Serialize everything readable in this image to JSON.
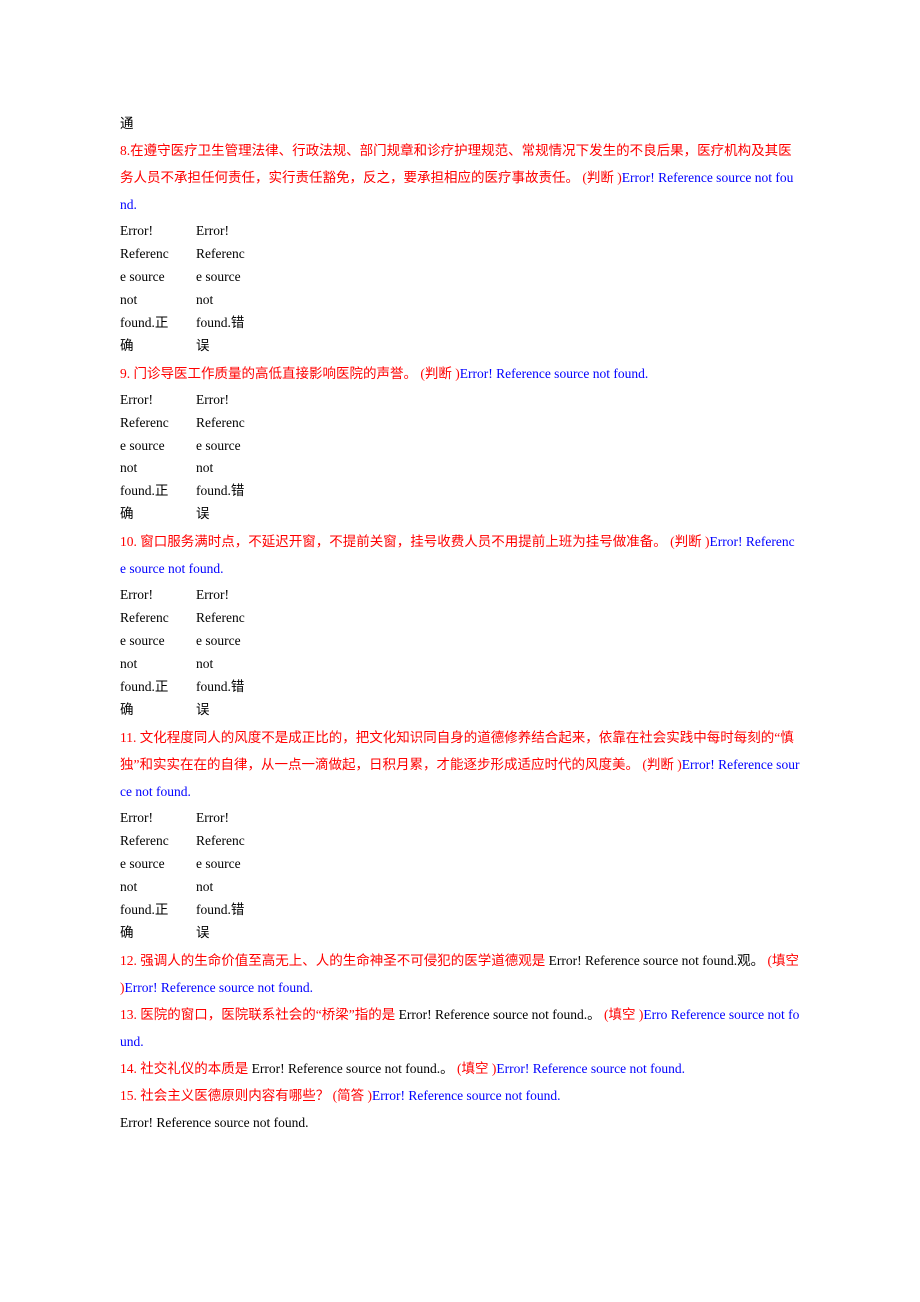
{
  "top_fragment": "通",
  "error_ref": "Error! Reference source not found.",
  "tf_correct_lines": [
    "Error!",
    "Referenc",
    "e source",
    "not",
    "found.正",
    "确"
  ],
  "tf_wrong_lines": [
    "Error!",
    "Referenc",
    "e source",
    "not",
    "found.错",
    "误"
  ],
  "q8": {
    "num": "8.",
    "text": "在遵守医疗卫生管理法律、行政法规、部门规章和诊疗护理规范、常规情况下发生的不良后果，医疗机构及其医务人员不承担任何责任，实行责任豁免，反之，要承担相应的医疗事故责任。",
    "type": " (判断 )"
  },
  "q9": {
    "num": "9. ",
    "text": "门诊导医工作质量的高低直接影响医院的声誉。",
    "type": " (判断 )"
  },
  "q10": {
    "num": "10. ",
    "text": "窗口服务满时点，不延迟开窗，不提前关窗，挂号收费人员不用提前上班为挂号做准备。",
    "type": " (判断 )",
    "error_prefix": "Error!"
  },
  "q11": {
    "num": "11. ",
    "text": "文化程度同人的风度不是成正比的，把文化知识同自身的道德修养结合起来，依靠在社会实践中每时每刻的“慎独”和实实在在的自律，从一点一滴做起，日积月累，才能逐步形成适应时代的风度美。",
    "type": " (判断 )"
  },
  "q12": {
    "num": "12. ",
    "text_a": "强调人的生命价值至高无上、人的生命神圣不可侵犯的医学道德观是",
    "err_a": " Error! Reference source not found.",
    "text_b": "观。",
    "type": " (填空 )"
  },
  "q13": {
    "num": "13. ",
    "text_a": "医院的窗口，医院联系社会的“桥梁”指的是",
    "err_a": " Error! Reference source not found.",
    "text_b": "。",
    "type": " (填空 )",
    "error_prefix": "Erro"
  },
  "q14": {
    "num": "14. ",
    "text_a": "社交礼仪的本质是",
    "err_a": " Error! Reference source not found.",
    "text_b": "。",
    "type": " (填空 )",
    "error_split_a": "Error! Reference source not ",
    "error_split_b": "found."
  },
  "q15": {
    "num": "15. ",
    "text": "社会主义医德原则内容有哪些？",
    "type": " (简答 )"
  },
  "q15_answer": "Error! Reference source not found."
}
